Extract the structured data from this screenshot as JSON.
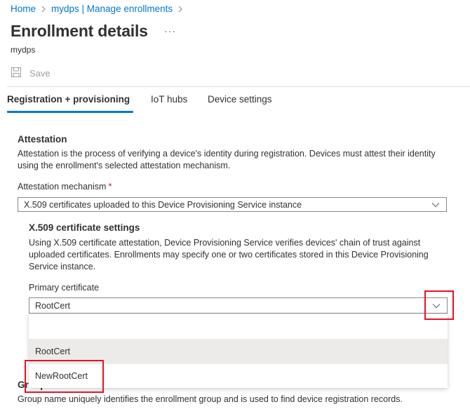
{
  "breadcrumb": {
    "items": [
      {
        "label": "Home"
      },
      {
        "label": "mydps | Manage enrollments"
      }
    ]
  },
  "header": {
    "title": "Enrollment details",
    "more_label": "···",
    "subtitle": "mydps"
  },
  "toolbar": {
    "save_label": "Save",
    "save_icon": "save-icon"
  },
  "tabs": [
    {
      "label": "Registration + provisioning",
      "active": true
    },
    {
      "label": "IoT hubs",
      "active": false
    },
    {
      "label": "Device settings",
      "active": false
    }
  ],
  "attestation": {
    "title": "Attestation",
    "description": "Attestation is the process of verifying a device's identity during registration. Devices must attest their identity using the enrollment's selected attestation mechanism.",
    "mechanism_label": "Attestation mechanism",
    "required_mark": "*",
    "mechanism_value": "X.509 certificates uploaded to this Device Provisioning Service instance"
  },
  "x509": {
    "title": "X.509 certificate settings",
    "description": "Using X.509 certificate attestation, Device Provisioning Service verifies devices' chain of trust against uploaded certificates. Enrollments may specify one or two certificates stored in this Device Provisioning Service instance.",
    "primary_label": "Primary certificate",
    "primary_value": "RootCert",
    "options": [
      {
        "label": ""
      },
      {
        "label": "RootCert",
        "selected": true
      },
      {
        "label": "NewRootCert",
        "selected": false
      }
    ]
  },
  "group": {
    "title": "Group name",
    "description": "Group name uniquely identifies the enrollment group and is used to find device registration records."
  },
  "colors": {
    "accent": "#0078d4",
    "highlight": "#e81123",
    "required": "#a4262c",
    "selected_option_bg": "#edebe9"
  }
}
